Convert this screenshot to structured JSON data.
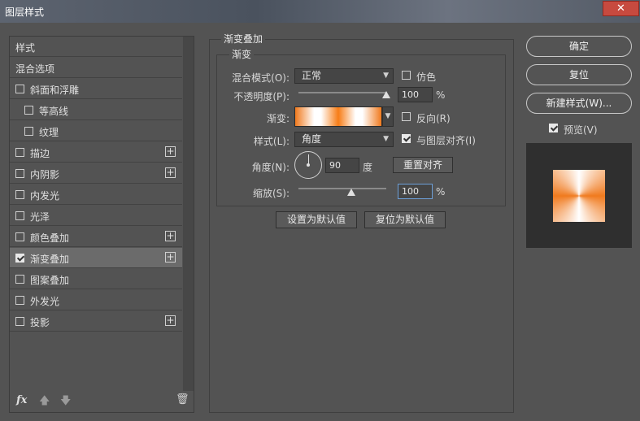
{
  "window": {
    "title": "图层样式",
    "close_icon": "close-icon"
  },
  "left_panel": {
    "items": [
      {
        "label": "样式"
      },
      {
        "label": "混合选项"
      },
      {
        "label": "斜面和浮雕"
      },
      {
        "label": "等高线"
      },
      {
        "label": "纹理"
      },
      {
        "label": "描边"
      },
      {
        "label": "内阴影"
      },
      {
        "label": "内发光"
      },
      {
        "label": "光泽"
      },
      {
        "label": "颜色叠加"
      },
      {
        "label": "渐变叠加"
      },
      {
        "label": "图案叠加"
      },
      {
        "label": "外发光"
      },
      {
        "label": "投影"
      }
    ],
    "footer": {
      "fx_label": "fx"
    }
  },
  "gradient_overlay": {
    "section_title": "渐变叠加",
    "group_title": "渐变",
    "blend_mode": {
      "label": "混合模式(O):",
      "value": "正常"
    },
    "dither": {
      "label": "仿色",
      "checked": false
    },
    "opacity": {
      "label": "不透明度(P):",
      "value": "100",
      "unit": "%",
      "level": 1.0
    },
    "gradient": {
      "label": "渐变:",
      "colors": [
        "#f07a1e",
        "#ffffff"
      ]
    },
    "reverse": {
      "label": "反向(R)",
      "checked": false
    },
    "style": {
      "label": "样式(L):",
      "value": "角度"
    },
    "align_with_layer": {
      "label": "与图层对齐(I)",
      "checked": true
    },
    "angle": {
      "label": "角度(N):",
      "value": "90",
      "unit": "度"
    },
    "reset_alignment": "重置对齐",
    "scale": {
      "label": "缩放(S):",
      "value": "100",
      "unit": "%",
      "level": 0.6
    },
    "make_default": "设置为默认值",
    "reset_default": "复位为默认值"
  },
  "right_panel": {
    "ok": "确定",
    "reset": "复位",
    "new_style": "新建样式(W)...",
    "preview_label": "预览(V)",
    "preview_checked": true
  },
  "colors": {
    "accent_orange": "#f07a1e",
    "panel_bg": "#535353",
    "selected_row": "#6b6b6b"
  }
}
